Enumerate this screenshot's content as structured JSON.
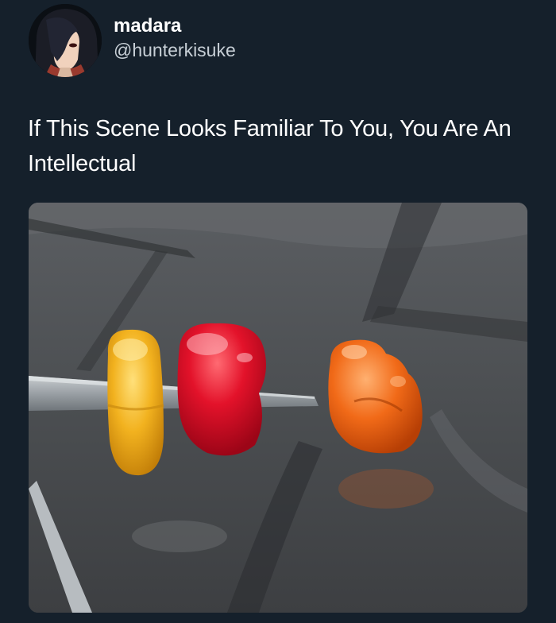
{
  "author": {
    "display_name": "madara",
    "handle": "@hunterkisuke",
    "avatar_icon": "anime-character-avatar"
  },
  "tweet": {
    "text": "If This Scene Looks Familiar To You, You Are An Intellectual"
  },
  "media": {
    "description_icon": "gummy-bears-on-scissors-photo"
  },
  "colors": {
    "background": "#15202b",
    "text": "#ffffff",
    "handle": "#c7cfd6"
  }
}
